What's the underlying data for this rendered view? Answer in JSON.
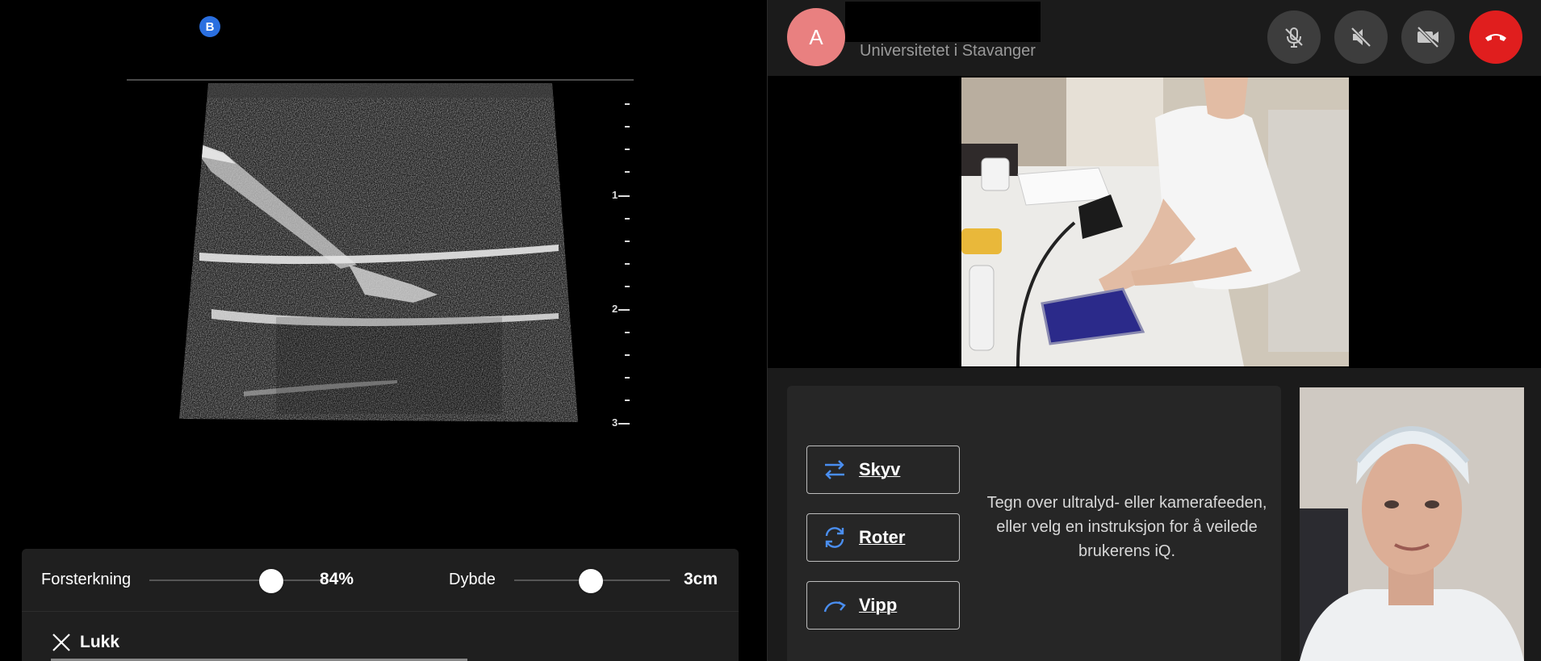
{
  "ultrasound": {
    "mode_badge": "B",
    "depth_labels": [
      "1",
      "2",
      "3"
    ]
  },
  "controls": {
    "gain_label": "Forsterkning",
    "gain_value": "84%",
    "gain_level": 0.84,
    "depth_label": "Dybde",
    "depth_value": "3cm",
    "depth_level": 0.5,
    "close_label": "Lukk"
  },
  "call": {
    "avatar_initial": "A",
    "organization": "Universitetet i Stavanger",
    "buttons": [
      "mic-muted-icon",
      "speaker-muted-icon",
      "camera-off-icon",
      "end-call-icon"
    ],
    "end_color": "#e01e1e"
  },
  "instructions": {
    "skyv_label": "Skyv",
    "roter_label": "Roter",
    "vipp_label": "Vipp",
    "hint": "Tegn over ultralyd- eller kamerafeeden, eller velg en instruksjon for å veilede brukerens iQ."
  },
  "colors": {
    "accent": "#4a8ef0",
    "avatar": "#e98080",
    "badge": "#2a6fe0"
  }
}
